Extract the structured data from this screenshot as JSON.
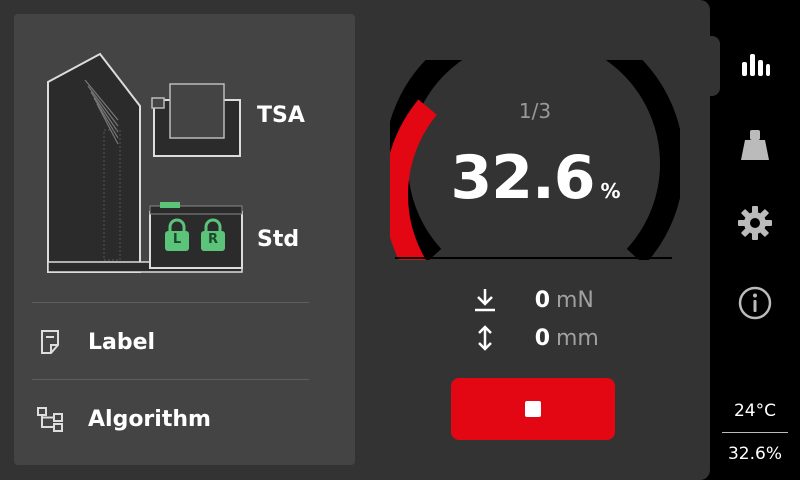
{
  "device": {
    "slot_top_label": "TSA",
    "slot_bottom_label": "Std",
    "lock_left": "L",
    "lock_right": "R"
  },
  "menu": {
    "items": [
      {
        "label": "Label",
        "icon": "document-icon"
      },
      {
        "label": "Algorithm",
        "icon": "tree-icon"
      }
    ]
  },
  "gauge": {
    "count": "1/3",
    "value": "32.6",
    "unit": "%",
    "fill_fraction": 0.326
  },
  "readouts": {
    "force": {
      "value": "0",
      "unit": "mN",
      "icon": "arrow-down-to-line-icon"
    },
    "distance": {
      "value": "0",
      "unit": "mm",
      "icon": "arrow-up-down-icon"
    }
  },
  "controls": {
    "stop_icon": "stop-icon"
  },
  "sidebar": {
    "icons": [
      "chart-bars-icon",
      "weight-icon",
      "gear-icon",
      "info-icon"
    ],
    "temperature": "24°C",
    "percentage": "32.6%"
  },
  "colors": {
    "accent": "#e30613",
    "lock_green": "#5cc47a"
  }
}
